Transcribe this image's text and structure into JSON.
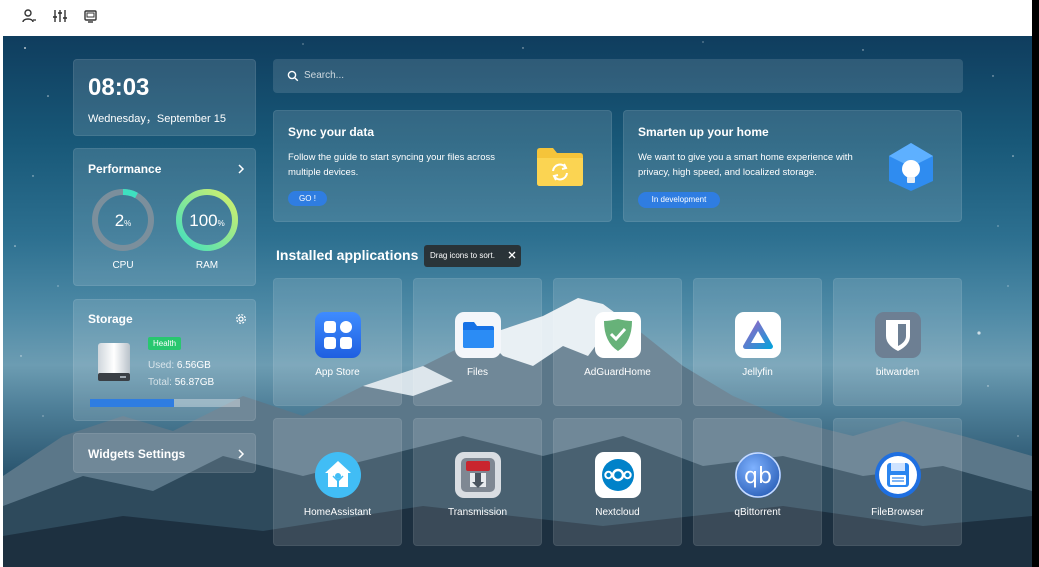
{
  "toolbar": {
    "icons": [
      "user-icon",
      "sliders-icon",
      "monitor-icon"
    ]
  },
  "clock": {
    "time": "08:03",
    "date": "Wednesday，September 15"
  },
  "performance": {
    "title": "Performance",
    "cpu": {
      "value": "2",
      "unit": "%",
      "label": "CPU",
      "fraction": 0.02
    },
    "ram": {
      "value": "100",
      "unit": "%",
      "label": "RAM",
      "fraction": 1.0
    }
  },
  "storage": {
    "title": "Storage",
    "health": "Health",
    "used_label": "Used:",
    "used_value": "6.56GB",
    "total_label": "Total:",
    "total_value": "56.87GB",
    "used_fraction": 0.56
  },
  "widgets": {
    "title": "Widgets Settings"
  },
  "search": {
    "placeholder": "Search..."
  },
  "banners": [
    {
      "title": "Sync your data",
      "text": "Follow the guide to start syncing your files across multiple devices.",
      "button": "GO !"
    },
    {
      "title": "Smarten up your home",
      "text": "We want to give you a smart home experience with privacy, high speed, and localized storage.",
      "button": "In development"
    }
  ],
  "apps_section": {
    "title": "Installed applications",
    "tip": "Drag icons to sort."
  },
  "apps": [
    {
      "name": "App Store",
      "icon": "app-store-icon"
    },
    {
      "name": "Files",
      "icon": "files-icon"
    },
    {
      "name": "AdGuardHome",
      "icon": "adguard-icon"
    },
    {
      "name": "Jellyfin",
      "icon": "jellyfin-icon"
    },
    {
      "name": "bitwarden",
      "icon": "bitwarden-icon"
    },
    {
      "name": "HomeAssistant",
      "icon": "homeassistant-icon"
    },
    {
      "name": "Transmission",
      "icon": "transmission-icon"
    },
    {
      "name": "Nextcloud",
      "icon": "nextcloud-icon"
    },
    {
      "name": "qBittorrent",
      "icon": "qbittorrent-icon"
    },
    {
      "name": "FileBrowser",
      "icon": "filebrowser-icon"
    }
  ],
  "colors": {
    "accent": "#2f7de1",
    "health": "#28c76f",
    "gauge_track": "#7b8f9c",
    "gauge_cpu": "#3ee0c0",
    "gauge_ram_start": "#3ee0c0",
    "gauge_ram_end": "#d6f06a"
  }
}
